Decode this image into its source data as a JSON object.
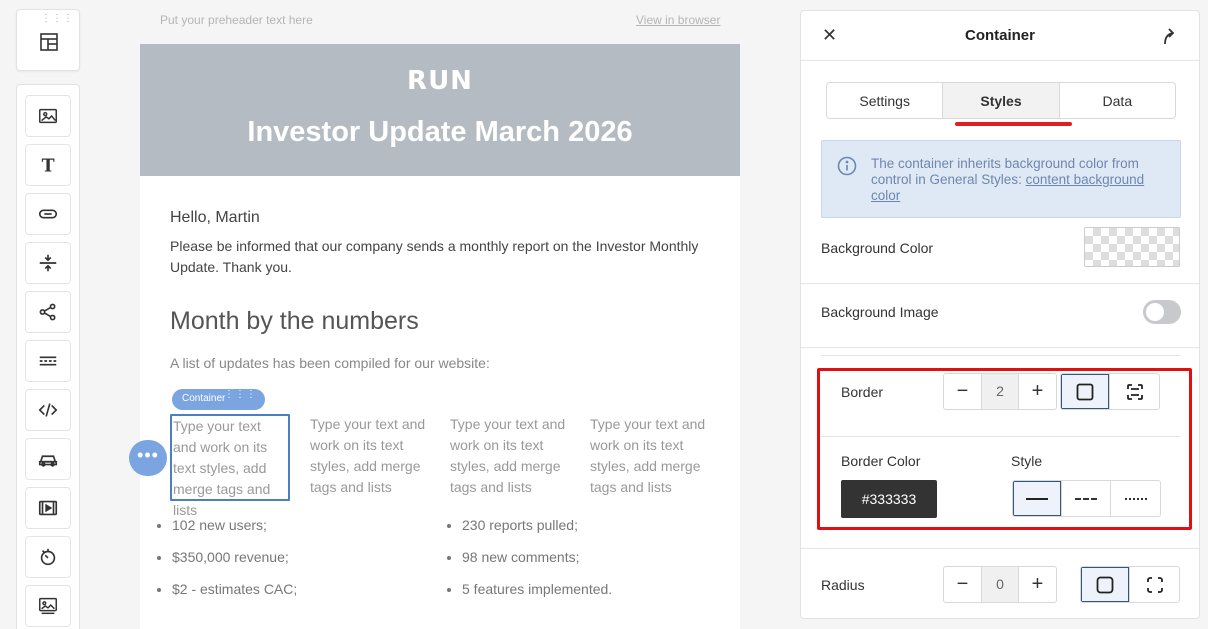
{
  "canvas": {
    "preheader": "Put your preheader text here",
    "view_in_browser": "View in browser"
  },
  "email": {
    "brand": "RUN",
    "headline": "Investor Update March 2026",
    "greeting": "Hello, Martin",
    "intro": "Please be informed that our company sends a monthly report on the Investor Monthly Update. Thank you.",
    "section_title": "Month by the numbers",
    "section_subtitle": "A list of updates has been compiled for our website:",
    "container_tag": "Container",
    "columns": [
      "Type your text and work on its text styles, add merge tags and lists",
      "Type your text and work on its text styles, add merge tags and lists",
      "Type your text and work on its text styles, add merge tags and lists",
      "Type your text and work on its text styles, add merge tags and lists"
    ],
    "bullets_left": [
      "102 new users;",
      "$350,000 revenue;",
      "$2 - estimates CAC;"
    ],
    "bullets_right": [
      "230 reports pulled;",
      "98 new comments;",
      "5 features implemented."
    ]
  },
  "toolbar": {
    "icons": [
      "image-icon",
      "text-icon",
      "button-icon",
      "spacer-icon",
      "social-icon",
      "divider-icon",
      "html-icon",
      "menu-icon",
      "video-icon",
      "timer-icon",
      "banner-icon"
    ]
  },
  "panel": {
    "title": "Container",
    "tabs": [
      "Settings",
      "Styles",
      "Data"
    ],
    "active_tab": "Styles",
    "info_text": "The container inherits background color from control in General Styles: ",
    "info_link": "content background color",
    "background_color_label": "Background Color",
    "background_image_label": "Background Image",
    "background_image_enabled": false,
    "border_label": "Border",
    "border_width": "2",
    "border_color_label": "Border Color",
    "border_color": "#333333",
    "style_label": "Style",
    "radius_label": "Radius",
    "radius_value": "0",
    "highlight_color": "#e01010"
  }
}
